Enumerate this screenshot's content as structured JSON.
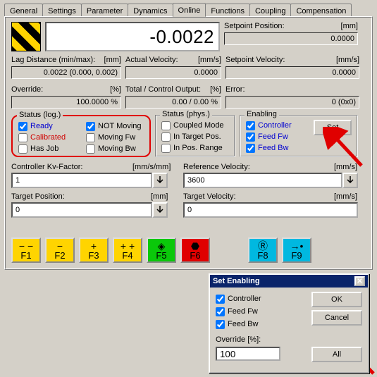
{
  "tabs": {
    "items": [
      {
        "label": "General"
      },
      {
        "label": "Settings"
      },
      {
        "label": "Parameter"
      },
      {
        "label": "Dynamics"
      },
      {
        "label": "Online"
      },
      {
        "label": "Functions"
      },
      {
        "label": "Coupling"
      },
      {
        "label": "Compensation"
      }
    ],
    "active_index": 4
  },
  "big_value": "-0.0022",
  "setpoint_position": {
    "label": "Setpoint Position:",
    "unit": "[mm]",
    "value": "0.0000"
  },
  "setpoint_velocity": {
    "label": "Setpoint Velocity:",
    "unit": "[mm/s]",
    "value": "0.0000"
  },
  "lag_distance": {
    "label": "Lag Distance (min/max):",
    "unit": "[mm]",
    "value": "0.0022 (0.000, 0.002)"
  },
  "actual_velocity": {
    "label": "Actual Velocity:",
    "unit": "[mm/s]",
    "value": "0.0000"
  },
  "override": {
    "label": "Override:",
    "unit": "[%]",
    "value": "100.0000 %"
  },
  "total_control": {
    "label": "Total / Control Output:",
    "unit": "[%]",
    "value": "0.00 / 0.00 %"
  },
  "error": {
    "label": "Error:",
    "value": "0 (0x0)"
  },
  "status_log": {
    "title": "Status (log.)",
    "items": [
      {
        "label": "Ready",
        "checked": true,
        "cls": "blue"
      },
      {
        "label": "Calibrated",
        "checked": false,
        "cls": "red"
      },
      {
        "label": "Has Job",
        "checked": false,
        "cls": ""
      },
      {
        "label": "NOT Moving",
        "checked": true,
        "cls": ""
      },
      {
        "label": "Moving Fw",
        "checked": false,
        "cls": ""
      },
      {
        "label": "Moving Bw",
        "checked": false,
        "cls": ""
      }
    ]
  },
  "status_phys": {
    "title": "Status (phys.)",
    "items": [
      {
        "label": "Coupled Mode",
        "checked": false
      },
      {
        "label": "In Target Pos.",
        "checked": false
      },
      {
        "label": "In Pos. Range",
        "checked": false
      }
    ]
  },
  "enabling": {
    "title": "Enabling",
    "items": [
      {
        "label": "Controller",
        "checked": true,
        "cls": "blue"
      },
      {
        "label": "Feed Fw",
        "checked": true,
        "cls": "blue"
      },
      {
        "label": "Feed Bw",
        "checked": true,
        "cls": "blue"
      }
    ],
    "set_label": "Set"
  },
  "kv": {
    "label": "Controller Kv-Factor:",
    "unit": "[mm/s/mm]",
    "value": "1"
  },
  "ref_vel": {
    "label": "Reference Velocity:",
    "unit": "[mm/s]",
    "value": "3600"
  },
  "target_pos": {
    "label": "Target Position:",
    "unit": "[mm]",
    "value": "0"
  },
  "target_vel": {
    "label": "Target Velocity:",
    "unit": "[mm/s]",
    "value": "0"
  },
  "fkeys": {
    "f1": "F1",
    "f2": "F2",
    "f3": "F3",
    "f4": "F4",
    "f5": "F5",
    "f6": "F6",
    "f8": "F8",
    "f9": "F9"
  },
  "dialog": {
    "title": "Set Enabling",
    "controller": {
      "label": "Controller",
      "checked": true
    },
    "feedfw": {
      "label": "Feed Fw",
      "checked": true
    },
    "feedbw": {
      "label": "Feed Bw",
      "checked": true
    },
    "override_label": "Override [%]:",
    "override_value": "100",
    "ok": "OK",
    "cancel": "Cancel",
    "all": "All"
  }
}
